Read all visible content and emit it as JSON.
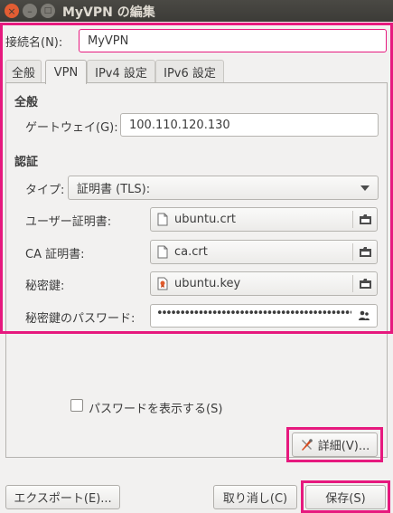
{
  "window": {
    "title": "MyVPN の編集",
    "close_glyph": "×",
    "minimize_glyph": "–",
    "maximize_glyph": "□"
  },
  "connection_name": {
    "label": "接続名(N):",
    "value": "MyVPN"
  },
  "tabs": [
    {
      "label": "全般",
      "active": false
    },
    {
      "label": "VPN",
      "active": true
    },
    {
      "label": "IPv4 設定",
      "active": false
    },
    {
      "label": "IPv6 設定",
      "active": false
    }
  ],
  "general_section": {
    "heading": "全般",
    "gateway_label": "ゲートウェイ(G):",
    "gateway_value": "100.110.120.130"
  },
  "auth_section": {
    "heading": "認証",
    "type_label": "タイプ:",
    "type_value": "証明書 (TLS):",
    "user_cert_label": "ユーザー証明書:",
    "user_cert_file": "ubuntu.crt",
    "ca_cert_label": "CA 証明書:",
    "ca_cert_file": "ca.crt",
    "private_key_label": "秘密鍵:",
    "private_key_file": "ubuntu.key",
    "key_password_label": "秘密鍵のパスワード:",
    "key_password_mask": "••••••••••••••••••••••••••••••••••••••••••••••••••••••"
  },
  "show_password": {
    "label": "パスワードを表示する(S)",
    "checked": false
  },
  "advanced_button": {
    "label": "詳細(V)...",
    "icon": "tools-icon"
  },
  "footer": {
    "export_label": "エクスポート(E)...",
    "cancel_label": "取り消し(C)",
    "save_label": "保存(S)"
  },
  "colors": {
    "highlight": "#e6197e",
    "close_button": "#e25d33",
    "titlebar": "#3c3b37"
  }
}
